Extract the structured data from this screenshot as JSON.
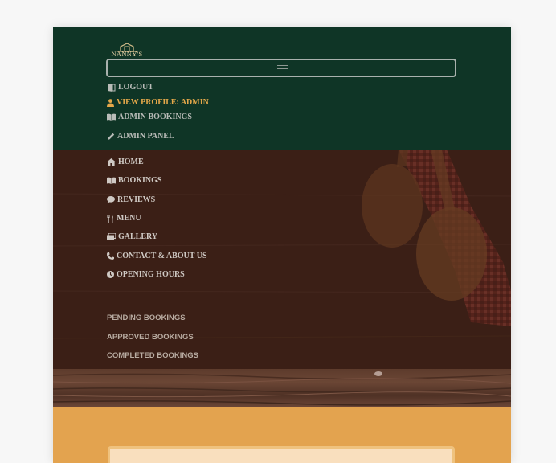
{
  "brand": {
    "name": "NANNY'S"
  },
  "navbar": {
    "toggler_icon": "hamburger-icon",
    "items": [
      {
        "label": "LOGOUT",
        "icon": "door-icon"
      },
      {
        "label": "VIEW PROFILE: ADMIN",
        "icon": "user-icon",
        "active": true
      },
      {
        "label": "ADMIN BOOKINGS",
        "icon": "book-icon"
      },
      {
        "label": "ADMIN PANEL",
        "icon": "pencil-icon"
      }
    ]
  },
  "dropdown": {
    "items": [
      {
        "label": "HOME",
        "icon": "home-icon"
      },
      {
        "label": "BOOKINGS",
        "icon": "book-icon"
      },
      {
        "label": "REVIEWS",
        "icon": "comment-icon"
      },
      {
        "label": "MENU",
        "icon": "utensils-icon"
      },
      {
        "label": "GALLERY",
        "icon": "images-icon"
      },
      {
        "label": "CONTACT & ABOUT US",
        "icon": "phone-icon"
      },
      {
        "label": "OPENING HOURS",
        "icon": "clock-icon"
      }
    ],
    "sub_items": [
      {
        "label": "PENDING BOOKINGS"
      },
      {
        "label": "APPROVED BOOKINGS"
      },
      {
        "label": "COMPLETED BOOKINGS"
      }
    ]
  },
  "colors": {
    "header_bg": "#0f3526",
    "dropdown_bg": "#3b1f16",
    "accent": "#e5a84a",
    "content_bg": "#e3a34f",
    "card_bg": "#f9dfbe"
  }
}
